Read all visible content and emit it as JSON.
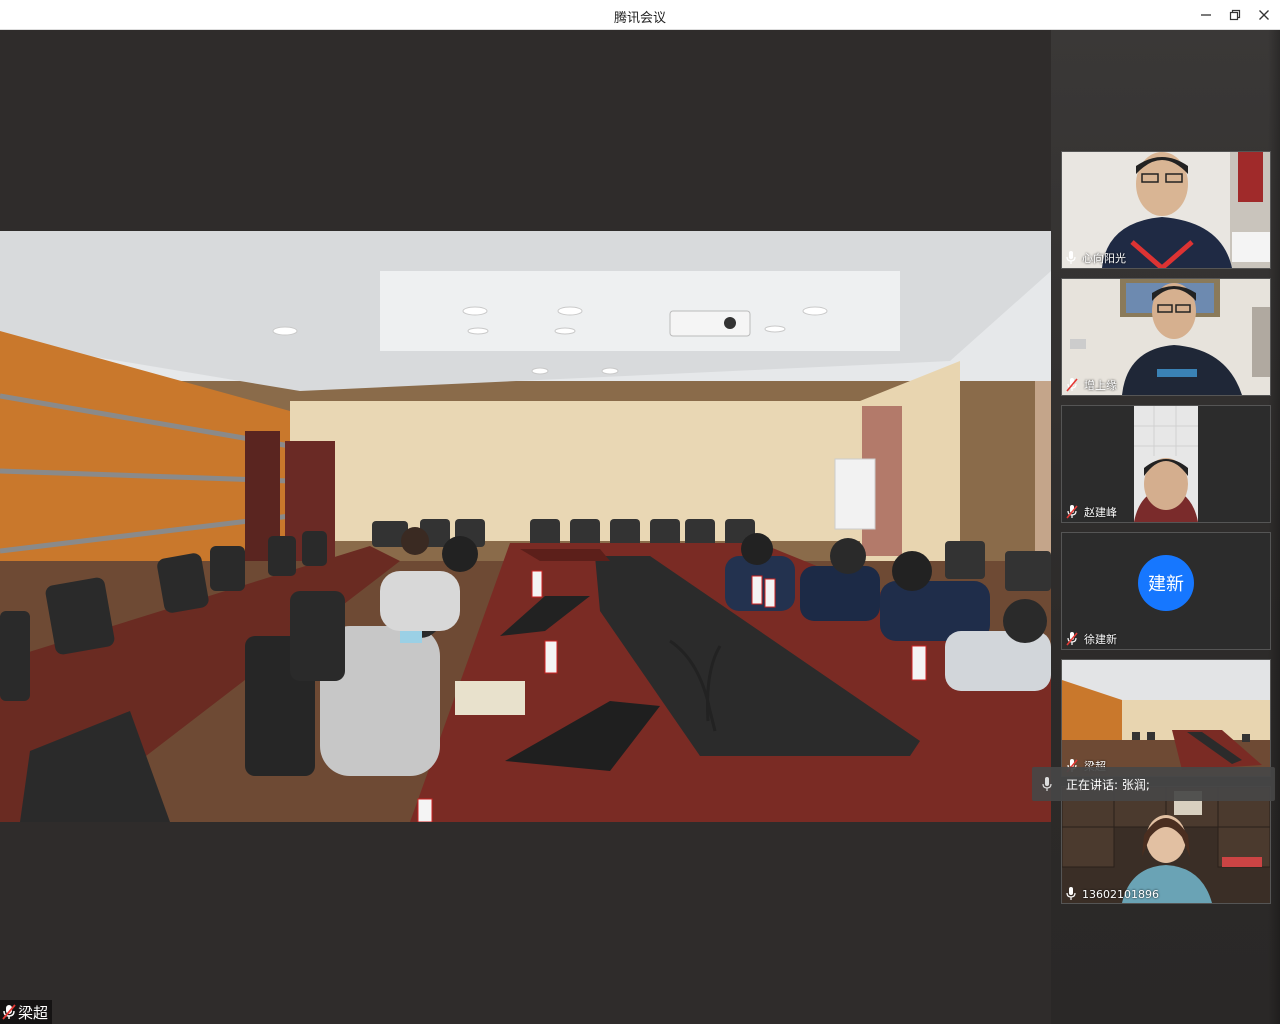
{
  "window": {
    "title": "腾讯会议",
    "minimize_icon": "minimize-icon",
    "restore_icon": "restore-icon",
    "close_icon": "close-icon"
  },
  "main_video": {
    "self_name": "梁超",
    "mic_icon": "mic-muted-icon"
  },
  "participants": [
    {
      "name": "心向阳光",
      "mic": "mic-icon",
      "type": "video"
    },
    {
      "name": "增上缘",
      "mic": "mic-muted-icon",
      "type": "video"
    },
    {
      "name": "赵建峰",
      "mic": "mic-muted-icon",
      "type": "video"
    },
    {
      "name": "徐建新",
      "mic": "mic-muted-icon",
      "type": "avatar",
      "avatar_text": "建新",
      "avatar_color": "#1677ff"
    },
    {
      "name": "梁超",
      "mic": "mic-muted-icon",
      "type": "video"
    },
    {
      "name": "13602101896",
      "mic": "mic-icon",
      "type": "video"
    }
  ],
  "speaking_indicator": {
    "text": "正在讲话: 张润;"
  }
}
